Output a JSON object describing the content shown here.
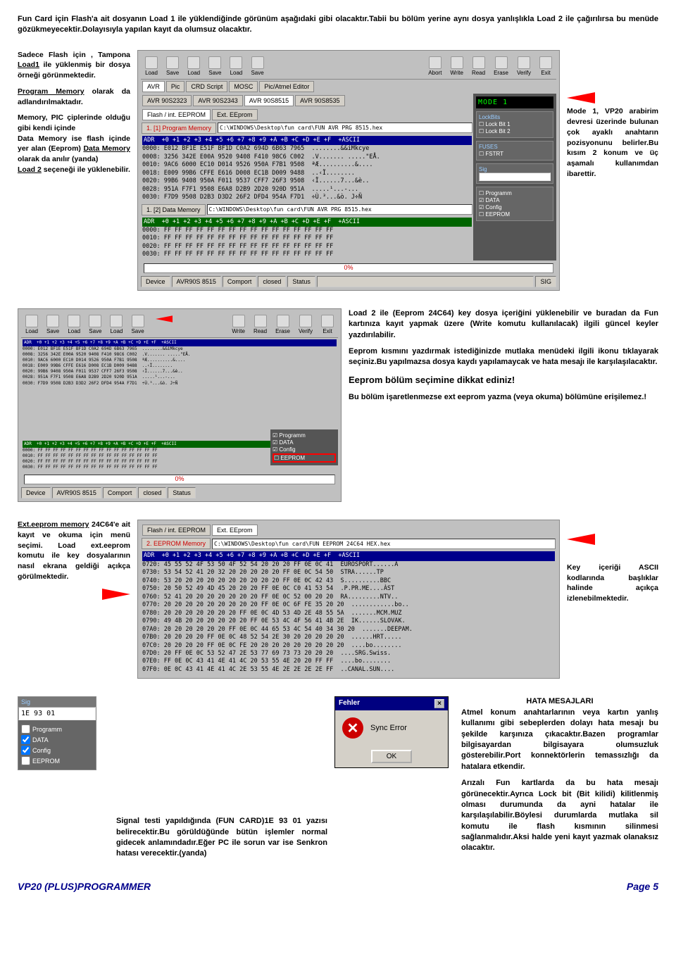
{
  "intro": "Fun Card için Flash'a ait dosyanın Load 1 ile yüklendiğinde görünüm aşağıdaki gibi olacaktır.Tabii bu bölüm yerine aynı dosya yanlışlıkla Load 2 ile çağırılırsa bu menüde gözükmeyecektir.Dolayısıyla yapılan kayıt da olumsuz olacaktır.",
  "s1": {
    "left1": "Sadece Flash için , Tampona ",
    "left1u": "Load1",
    "left1b": " ile yüklenmiş bir dosya örneği görünmektedir.",
    "left2u": "Program Memory",
    "left2": " olarak da adlandırılmaktadır.",
    "left3a": "Memory, PIC çiplerinde olduğu gibi kendi içinde",
    "left3b": "Data Memory ise flash içinde yer alan (Eeprom) ",
    "left3u": "Data Memory",
    "left3c": " olarak da anılır (yanda)",
    "left3d": "Load 2",
    "left3e": " seçeneği ile yüklenebilir.",
    "right": "Mode 1, VP20 arabirim devresi üzerinde bulunan çok ayaklı anahtarın pozisyonunu belirler.Bu kısım 2 konum ve üç aşamalı kullanımdan ibarettir."
  },
  "toolbar": [
    "Load",
    "Save",
    "Load",
    "Save",
    "Load",
    "Save",
    "",
    "Abort",
    "Write",
    "Read",
    "Erase",
    "Verify",
    "Exit"
  ],
  "tabs1": [
    "AVR",
    "Pic",
    "CRD Script",
    "MOSC",
    "Pic/Atmel Editor"
  ],
  "tabs2": [
    "AVR 90S2323",
    "AVR 90S2343",
    "AVR 90S8515",
    "AVR 90S8535"
  ],
  "tabs3": [
    "Flash / int. EEPROM",
    "Ext. EEprom"
  ],
  "mem1label": "1. [1] Program Memory",
  "mem1path": "C:\\WINDOWS\\Desktop\\fun card\\FUN AVR PRG 8515.hex",
  "hex1hdr": "ADR  +0 +1 +2 +3 +4 +5 +6 +7 +8 +9 +A +B +C +D +E +F  +ASCII",
  "hex1": "0000: E012 BF1E E51F BF1D C0A2 694D 6B63 7965  ........&&iMkcye\n0008: 3256 342E E00A 9520 9408 F410 98C6 C002  .V....... .....\"EÅ.\n0010: 9AC6 6000 EC10 D014 9526 950A F7B1 9508  ªÆ..........&....\n0018: E009 99B6 CFFE E616 D008 EC1B D009 9488  ..‹Ï........\n0020: 99B6 9408 950A F011 9537 CFF7 26F3 9508  ‹Ï......7...&è..\n0028: 951A F7F1 9508 E6A8 D2B9 2D20 920D 951A  .....¹...-...\n0030: F7D9 9508 D2B3 D3D2 26F2 DFD4 954A F7D1  ÷Ù.³...&ò. J÷Ñ",
  "mem2label": "1. [2] Data Memory",
  "mem2path": "C:\\WINDOWS\\Desktop\\fun card\\FUN AVR PRG 8515.hex",
  "hex2hdr": "ADR  +0 +1 +2 +3 +4 +5 +6 +7 +8 +9 +A +B +C +D +E +F  +ASCII",
  "hex2": "0000: FF FF FF FF FF FF FF FF FF FF FF FF FF FF FF FF\n0010: FF FF FF FF FF FF FF FF FF FF FF FF FF FF FF FF\n0020: FF FF FF FF FF FF FF FF FF FF FF FF FF FF FF FF\n0030: FF FF FF FF FF FF FF FF FF FF FF FF FF FF FF FF",
  "mode1": "MODE 1",
  "lockbits": "LockBits",
  "lock1": "Lock Bit 1",
  "lock2": "Lock Bit 2",
  "fuses": "FUSES",
  "fstrt": "FSTRT",
  "sig": "Sig",
  "programm": "Programm",
  "data": "DATA",
  "config": "Config",
  "eeprom": "EEPROM",
  "pct": "0%",
  "status": {
    "device": "Device",
    "devv": "AVR90S 8515",
    "comport": "Comport",
    "closed": "closed",
    "stat": "Status",
    "sigl": "SIG"
  },
  "s2": {
    "p1": "Load 2 ile (Eeprom 24C64) key dosya içeriğini yüklenebilir ve buradan da  Fun kartınıza kayıt yapmak üzere (Write komutu kullanılacak) ilgili güncel keyler yazdırılabilir.",
    "p2": "Eeprom kısmını yazdırmak istediğinizde mutlaka menüdeki ilgili ikonu tıklayarak seçiniz.Bu yapılmazsa dosya kaydı yapılamaycak ve hata mesajı ile karşılaşılacaktır.",
    "h": "Eeprom bölüm seçimine dikkat ediniz!",
    "p3": "Bu bölüm işaretlenmezse ext eeprom yazma (veya okuma) bölümüne erişilemez.!"
  },
  "s3": {
    "left1u": "Ext.eeprom memory",
    "left1": " 24C64'e ait kayıt ve okuma için menü seçimi. Load ext.eeprom komutu ile key dosyalarının nasıl ekrana geldiği açıkça görülmektedir.",
    "right": "Key içeriği ASCII kodlarında başlıklar halinde açıkça izlenebilmektedir."
  },
  "eetabs": [
    "Flash / int. EEPROM",
    "Ext. EEprom"
  ],
  "eelabel": "2. EEPROM Memory",
  "eepath": "C:\\WINDOWS\\Desktop\\fun card\\FUN EEPROM 24C64 HEX.hex",
  "eehdr": "ADR  +0 +1 +2 +3 +4 +5 +6 +7 +8 +9 +A +B +C +D +E +F  +ASCII",
  "eehex": "0720: 45 55 52 4F 53 50 4F 52 54 20 20 20 FF 0E 0C 41  EUROSPORT......A\n0730: 53 54 52 41 20 32 20 20 20 20 20 FF 0E 0C 54 50  STRA......TP\n0740: 53 20 20 20 20 20 20 20 20 20 20 FF 0E 0C 42 43  S..........BBC\n0750: 20 50 52 49 4D 45 20 20 20 FF 0E 0C C0 41 53 54  .P.PR.ME....ÀST\n0760: 52 41 20 20 20 20 20 20 20 FF 0E 0C 52 00 20 20  RA.........NTV..\n0770: 20 20 20 20 20 20 20 20 20 FF 0E 0C 6F FE 35 20 20  ............bo..\n0780: 20 20 20 20 20 20 20 FF 0E 0C 4D 53 4D 2E 48 55 5A  .......MCM.MUZ\n0790: 49 4B 20 20 20 20 20 20 FF 0E 53 4C 4F 56 41 4B 2E  IK......SLOVAK.\n07A0: 20 20 20 20 20 20 FF 0E 0C 44 65 53 4C 54 40 34 30 20  .......DEEPAM.\n07B0: 20 20 20 20 FF 0E 0C 48 52 54 2E 30 20 20 20 20 20  ......HRT.....\n07C0: 20 20 20 20 FF 0E 0C FE 20 20 20 20 20 20 20 20 20  ....bo........\n07D0: 20 FF 0E 0C 53 52 47 2E 53 77 69 73 73 20 20 20  ....SRG.Swiss.\n07E0: FF 0E 0C 43 41 4E 41 4C 20 53 55 4E 20 20 FF FF  ....bo........\n07F0: 0E 0C 43 41 4E 41 4C 2E 53 55 4E 2E 2E 2E 2E FF  ..CANAL.SUN....",
  "s4": {
    "sigval": "1E 93 01",
    "sigp1": "Signal testi yapıldığında (FUN CARD)1E 93 01 yazısı belirecektir.Bu görüldüğünde bütün işlemler normal gidecek anlamındadır.Eğer PC ile sorun var ise Senkron hatası verecektir.(yanda)",
    "ftitle": "Fehler",
    "ferr": "Sync Error",
    "fok": "OK",
    "rtitle": "HATA MESAJLARI",
    "r1": "Atmel konum anahtarlarının veya kartın yanlış kullanımı gibi sebeplerden dolayı  hata mesajı bu şekilde  karşınıza çıkacaktır.Bazen programlar bilgisayardan bilgisayara olumsuzluk gösterebilir.Port konnektörlerin temassızlığı da hatalara etkendir.",
    "r2": "Arızalı Fun kartlarda da bu hata mesajı görünecektir.Ayrıca Lock bit (Bit kilidi) kilitlenmiş olması durumunda da ayni hatalar ile karşılaşılabilir.Böylesi durumlarda mutlaka sil komutu ile flash kısmının silinmesi sağlanmalıdır.Aksi halde yeni kayıt yazmak olanaksız olacaktır."
  },
  "footer": {
    "l": "VP20 (PLUS)PROGRAMMER",
    "r": "Page 5"
  }
}
